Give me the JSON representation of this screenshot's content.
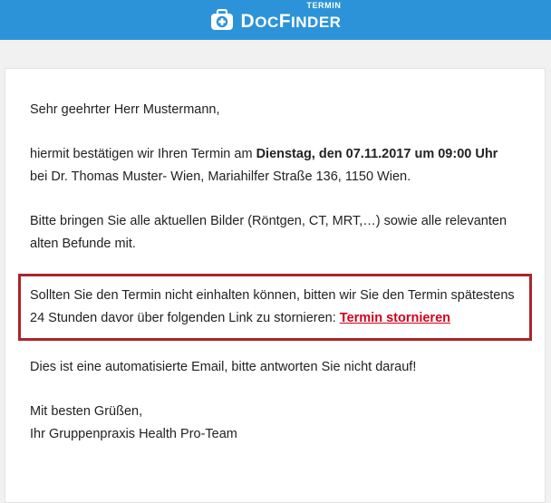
{
  "header": {
    "brand_part1": "D",
    "brand_part2": "OC",
    "brand_part3": "F",
    "brand_part4": "INDER",
    "brand_tag": "TERMIN",
    "background_color": "#2d93d8"
  },
  "email": {
    "greeting": "Sehr geehrter Herr Mustermann,",
    "confirm_intro": "hiermit bestätigen wir Ihren Termin am ",
    "appointment_date": "Dienstag, den 07.11.2017 um 09:00 Uhr",
    "doctor_line": "bei Dr. Thomas Muster- Wien, Mariahilfer Straße 136, 1150 Wien.",
    "bring_text": "Bitte bringen Sie alle aktuellen Bilder (Röntgen, CT, MRT,…) sowie alle relevanten alten Befunde mit.",
    "cancel_text": "Sollten Sie den Termin nicht einhalten können, bitten wir Sie den Termin spätestens 24 Stunden davor über folgenden Link zu stornieren: ",
    "cancel_link": "Termin stornieren",
    "auto_notice": "Dies ist eine automatisierte Email, bitte antworten Sie nicht darauf!",
    "closing": "Mit besten Grüßen,",
    "signature": "Ihr Gruppenpraxis Health Pro-Team",
    "highlight_color": "#a9262b",
    "link_color": "#d0021b"
  }
}
